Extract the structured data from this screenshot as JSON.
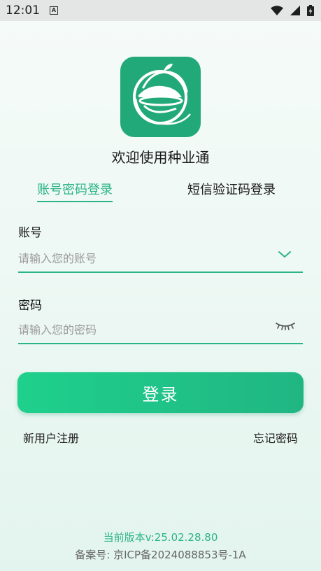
{
  "status_bar": {
    "time": "12:01",
    "notification_icon": "a-icon",
    "wifi_icon": "wifi-icon",
    "signal_icon": "signal-icon",
    "battery_icon": "battery-charging-icon"
  },
  "app": {
    "logo_icon": "app-logo-icon",
    "brand_color": "#22a97a",
    "title": "欢迎使用种业通"
  },
  "tabs": [
    {
      "label": "账号密码登录",
      "active": true
    },
    {
      "label": "短信验证码登录",
      "active": false
    }
  ],
  "form": {
    "account": {
      "label": "账号",
      "value": "",
      "placeholder": "请输入您的账号",
      "icon": "chevron-down-icon"
    },
    "password": {
      "label": "密码",
      "value": "",
      "placeholder": "请输入您的密码",
      "icon": "eye-closed-icon"
    },
    "login_label": "登录"
  },
  "links": {
    "register": "新用户注册",
    "forgot": "忘记密码"
  },
  "footer": {
    "version": "当前版本v:25.02.28.80",
    "icp": "备案号: 京ICP备2024088853号-1A"
  },
  "colors": {
    "accent": "#2bb488",
    "button_start": "#1fd08c",
    "button_end": "#20b683"
  }
}
